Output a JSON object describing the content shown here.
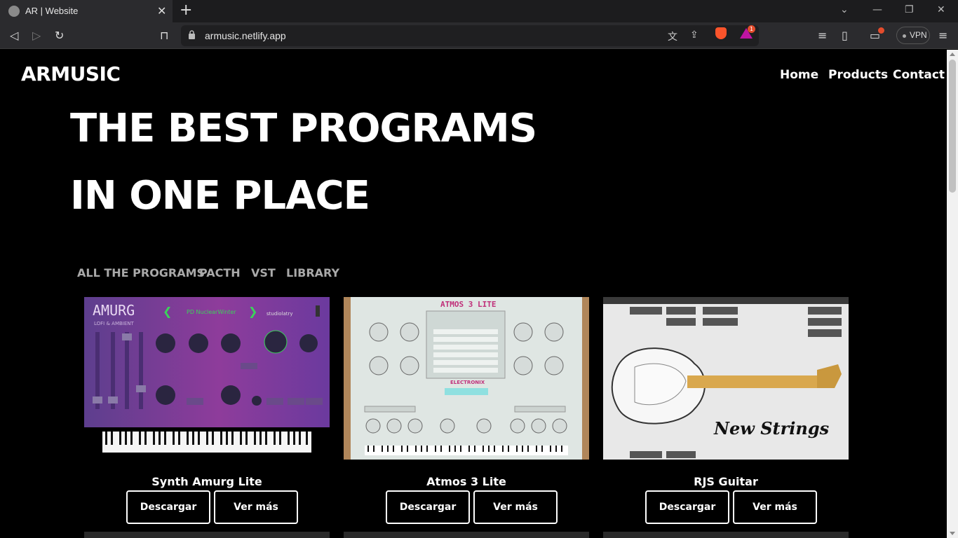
{
  "browser": {
    "tab_title": "AR | Website",
    "url": "armusic.netlify.app",
    "vpn_label": "VPN",
    "alert_count": "1"
  },
  "header": {
    "logo": "ARMUSIC",
    "nav": [
      "Home",
      "Products",
      "Contact"
    ]
  },
  "hero": {
    "line1": "THE BEST PROGRAMS",
    "line2": "IN ONE PLACE"
  },
  "filters": [
    "ALL THE PROGRAMS",
    "PACTH",
    "VST",
    "LIBRARY"
  ],
  "products": [
    {
      "name": "Synth Amurg Lite",
      "download_label": "Descargar",
      "more_label": "Ver más",
      "image_text": {
        "brand": "AMURG",
        "sub": "LOFI & AMBIENT",
        "preset": "PD NuclearWinter",
        "maker": "studiolatry"
      }
    },
    {
      "name": "Atmos 3 Lite",
      "download_label": "Descargar",
      "more_label": "Ver más",
      "image_text": {
        "brand": "ATMOS 3 LITE",
        "logo": "ELECTRONIX"
      }
    },
    {
      "name": "RJS Guitar",
      "download_label": "Descargar",
      "more_label": "Ver más",
      "image_text": {
        "script": "New Strings"
      }
    }
  ],
  "colors": {
    "accent_purple": "#7a3fa0",
    "synth_green": "#3bd35a",
    "brave": "#fb542b"
  }
}
